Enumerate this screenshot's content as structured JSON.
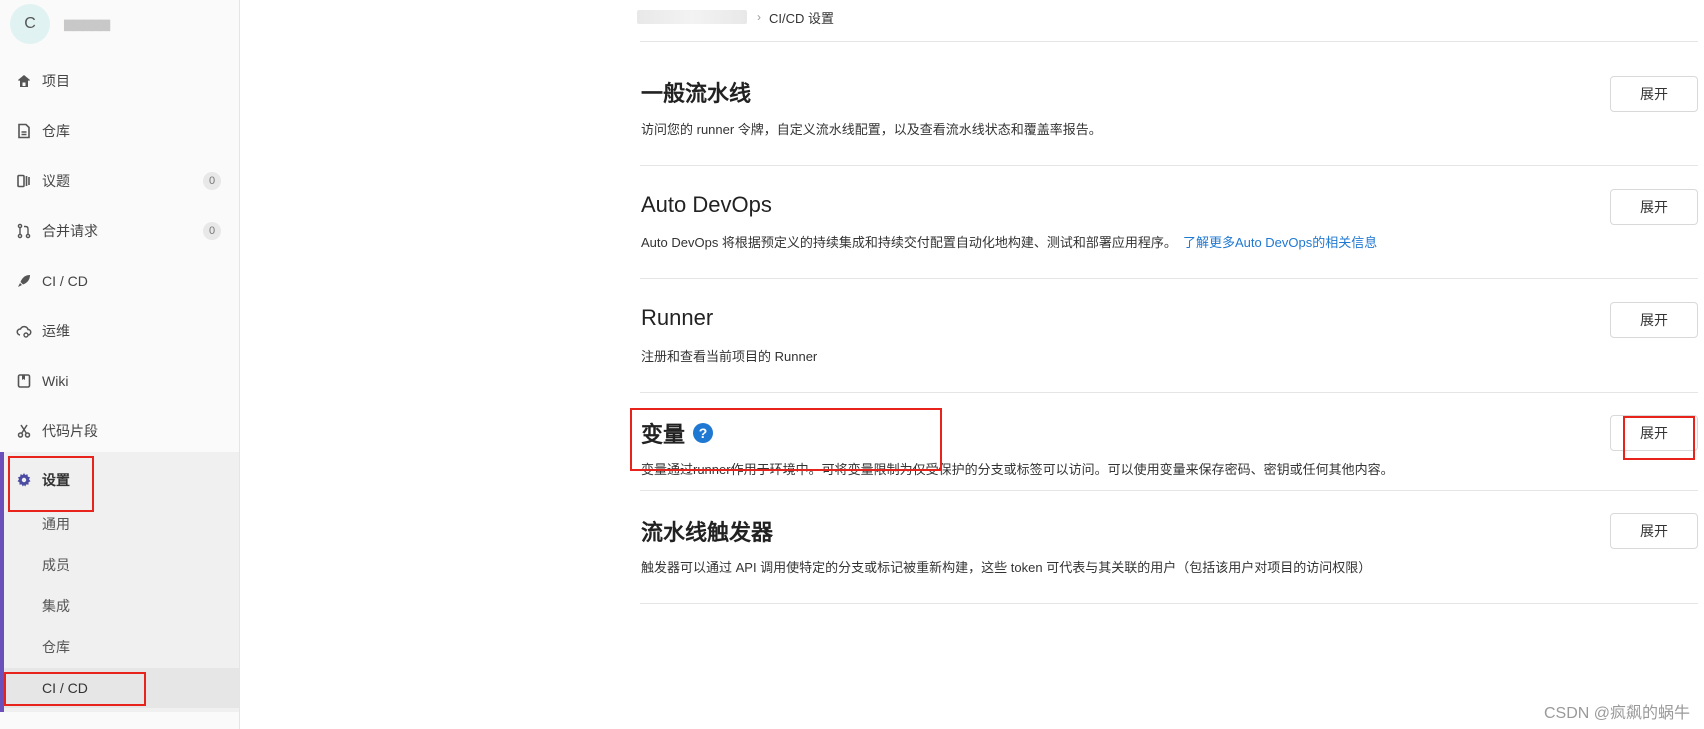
{
  "sidebar": {
    "avatar_letter": "C",
    "project_name": "▆▆▆▆▆",
    "items": [
      {
        "label": "项目",
        "icon": "home-icon"
      },
      {
        "label": "仓库",
        "icon": "document-icon"
      },
      {
        "label": "议题",
        "icon": "issues-icon",
        "badge": "0"
      },
      {
        "label": "合并请求",
        "icon": "merge-request-icon",
        "badge": "0"
      },
      {
        "label": "CI / CD",
        "icon": "rocket-icon"
      },
      {
        "label": "运维",
        "icon": "cloud-gear-icon"
      },
      {
        "label": "Wiki",
        "icon": "book-icon"
      },
      {
        "label": "代码片段",
        "icon": "scissors-icon"
      },
      {
        "label": "设置",
        "icon": "gear-icon"
      }
    ],
    "settings_sub": [
      "通用",
      "成员",
      "集成",
      "仓库",
      "CI / CD"
    ]
  },
  "breadcrumb": {
    "current": "CI/CD 设置"
  },
  "sections": [
    {
      "title": "一般流水线",
      "desc": "访问您的 runner 令牌，自定义流水线配置，以及查看流水线状态和覆盖率报告。",
      "button": "展开"
    },
    {
      "title": "Auto DevOps",
      "desc": "Auto DevOps 将根据预定义的持续集成和持续交付配置自动化地构建、测试和部署应用程序。",
      "link": "了解更多Auto DevOps的相关信息",
      "button": "展开"
    },
    {
      "title": "Runner",
      "desc": "注册和查看当前项目的 Runner",
      "button": "展开"
    },
    {
      "title": "变量",
      "desc": "变量通过runner作用于环境中。可将变量限制为仅受保护的分支或标签可以访问。可以使用变量来保存密码、密钥或任何其他内容。",
      "button": "展开"
    },
    {
      "title": "流水线触发器",
      "desc": "触发器可以通过 API 调用使特定的分支或标记被重新构建，这些 token 可代表与其关联的用户（包括该用户对项目的访问权限）",
      "button": "展开"
    }
  ],
  "watermark": "CSDN @疯飙的蜗牛",
  "colors": {
    "accent_purple": "#6b4fbb",
    "link_blue": "#1f78d1",
    "annotation_red": "#e8231c"
  }
}
